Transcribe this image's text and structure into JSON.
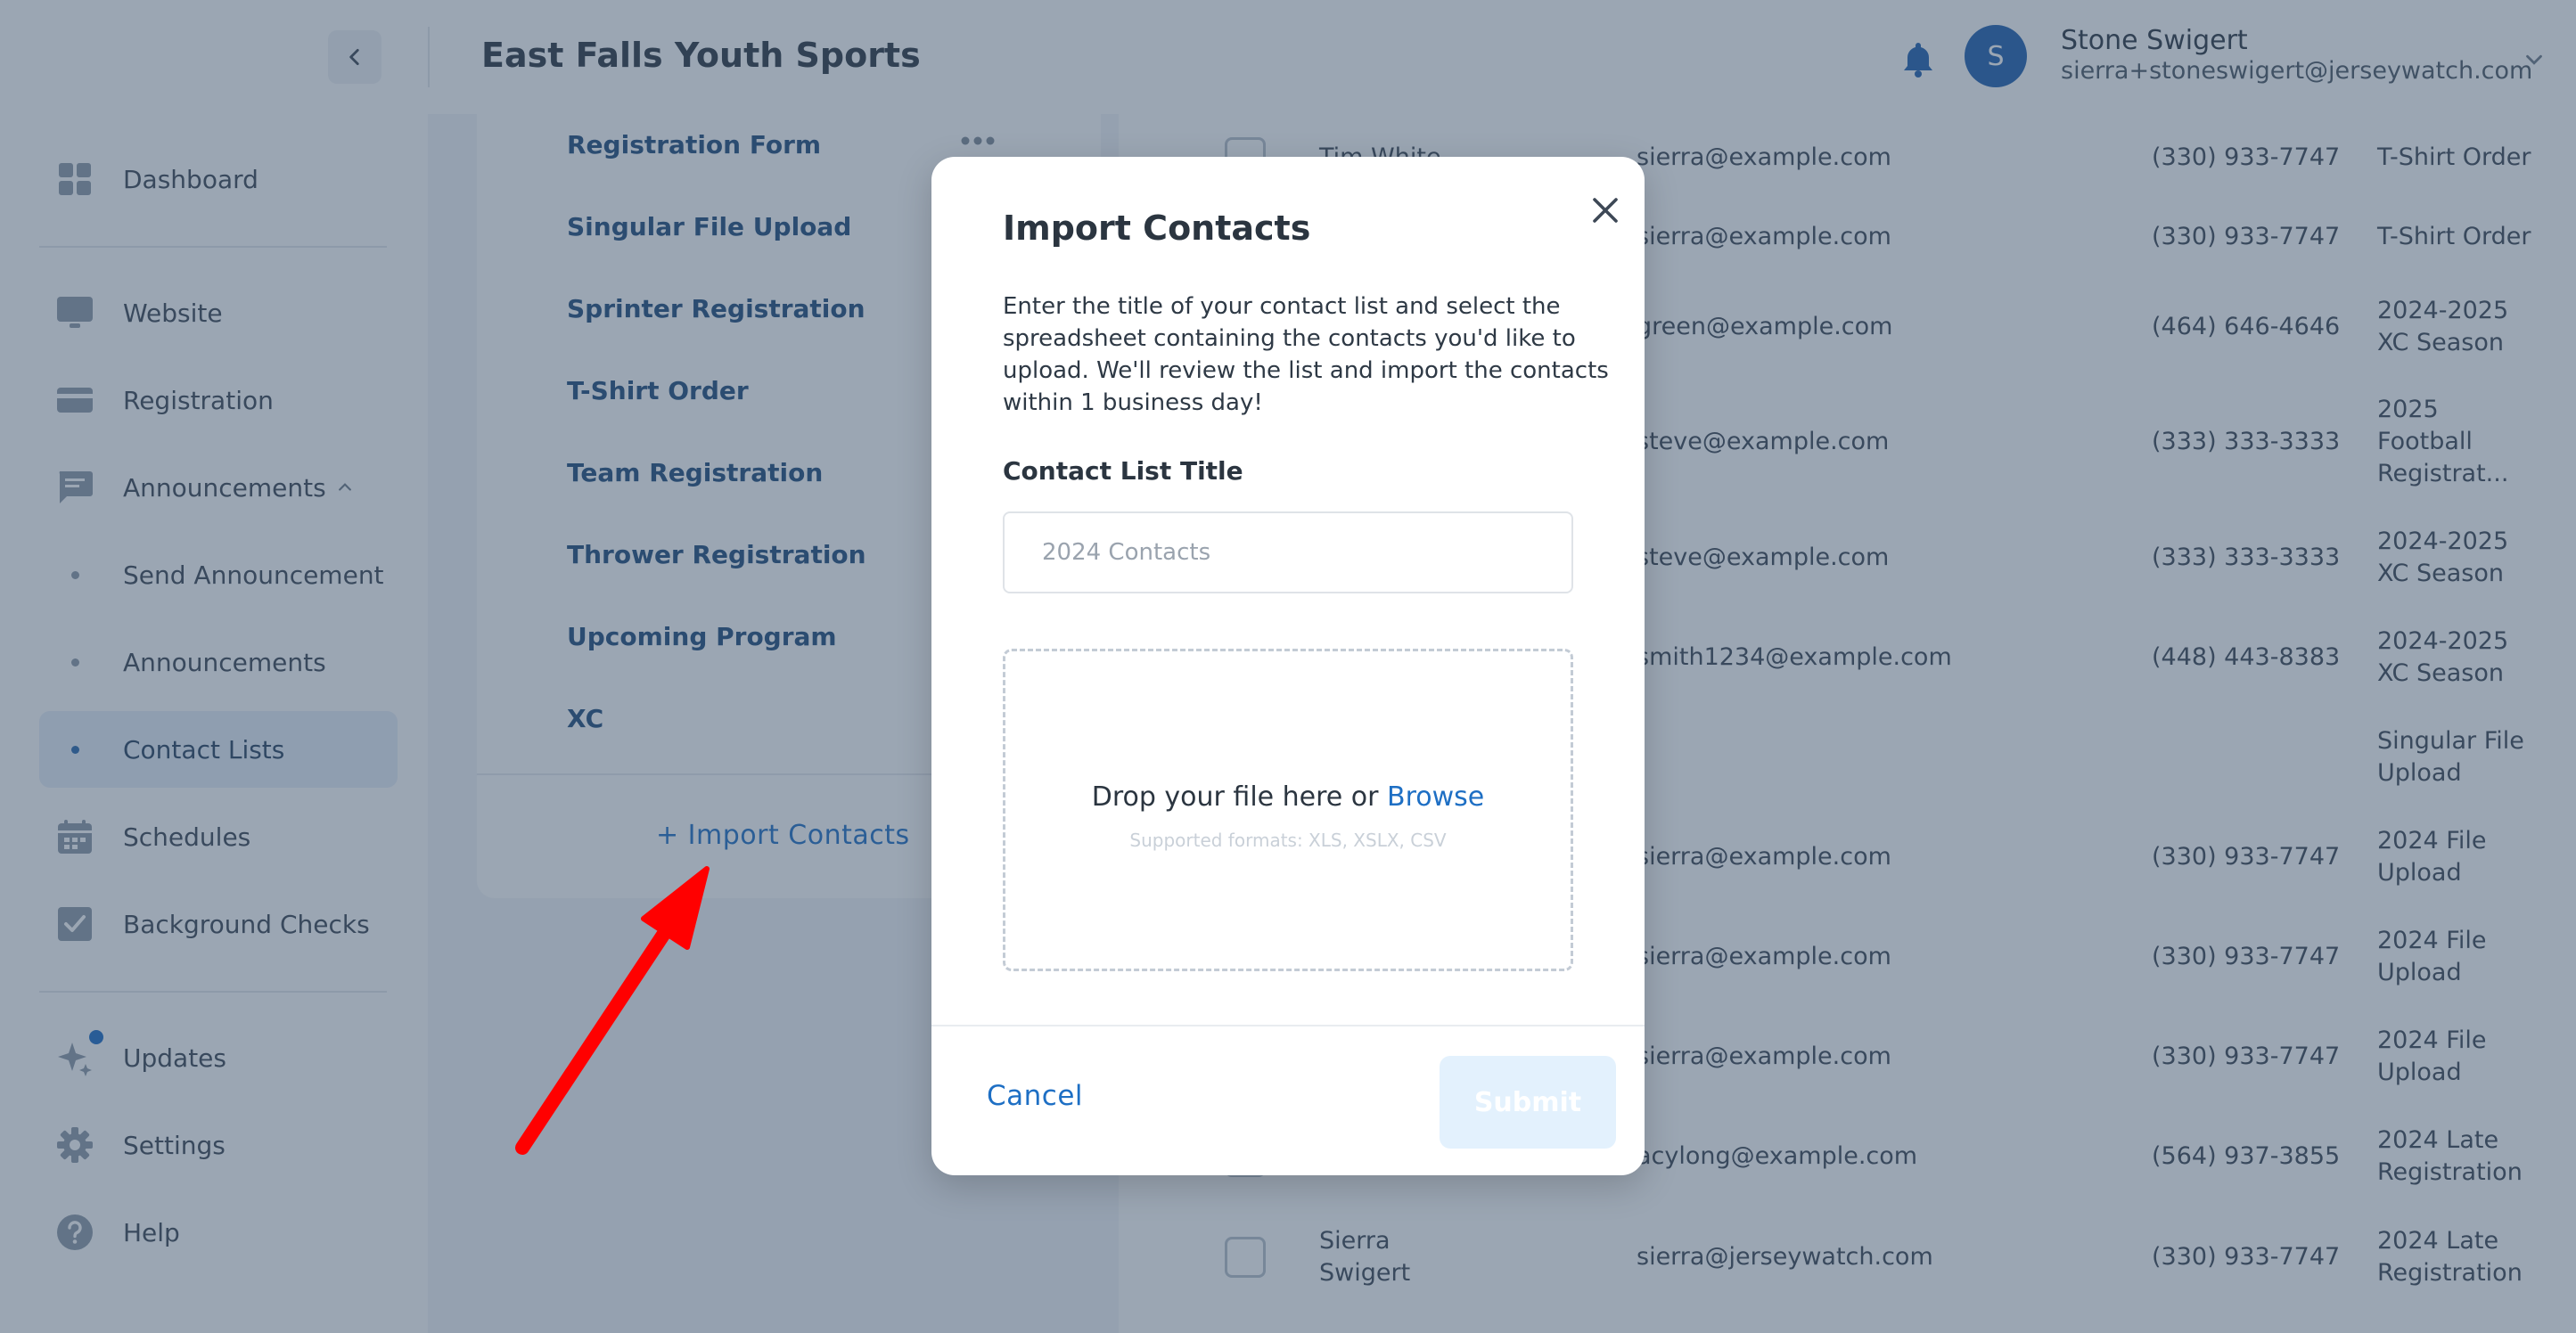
{
  "header": {
    "org_title": "East Falls Youth Sports",
    "user": {
      "initial": "S",
      "name": "Stone Swigert",
      "email": "sierra+stoneswigert@jerseywatch.com"
    }
  },
  "sidebar": {
    "items": [
      {
        "label": "Dashboard",
        "icon": "dashboard-icon"
      },
      {
        "label": "Website",
        "icon": "monitor-icon"
      },
      {
        "label": "Registration",
        "icon": "card-icon"
      },
      {
        "label": "Announcements",
        "icon": "chat-icon"
      },
      {
        "label": "Send Announcement"
      },
      {
        "label": "Announcements"
      },
      {
        "label": "Contact Lists",
        "active": true
      },
      {
        "label": "Schedules",
        "icon": "calendar-icon"
      },
      {
        "label": "Background Checks",
        "icon": "checkbox-icon"
      },
      {
        "label": "Updates",
        "icon": "sparkle-icon"
      },
      {
        "label": "Settings",
        "icon": "gear-icon"
      },
      {
        "label": "Help",
        "icon": "help-icon"
      }
    ]
  },
  "contact_lists": {
    "items": [
      "Registration Form",
      "Singular File Upload",
      "Sprinter Registration",
      "T-Shirt Order",
      "Team Registration",
      "Thrower Registration",
      "Upcoming Program",
      "XC"
    ],
    "import_label": "+ Import Contacts"
  },
  "table": {
    "rows": [
      {
        "name": "Tim White",
        "email": "sierra@example.com",
        "phone": "(330) 933-7747",
        "program": "T-Shirt Order"
      },
      {
        "name": "",
        "email": "sierra@example.com",
        "phone": "(330) 933-7747",
        "program": "T-Shirt Order"
      },
      {
        "name": "",
        "email": "green@example.com",
        "phone": "(464) 646-4646",
        "program": "2024-2025\nXC Season"
      },
      {
        "name": "",
        "email": "steve@example.com",
        "phone": "(333) 333-3333",
        "program": "2025\nFootball\nRegistrat..."
      },
      {
        "name": "",
        "email": "steve@example.com",
        "phone": "(333) 333-3333",
        "program": "2024-2025\nXC Season"
      },
      {
        "name": "",
        "email": "smith1234@example.com",
        "phone": "(448) 443-8383",
        "program": "2024-2025\nXC Season"
      },
      {
        "name": "",
        "email": "",
        "phone": "",
        "program": "Singular File\nUpload"
      },
      {
        "name": "",
        "email": "sierra@example.com",
        "phone": "(330) 933-7747",
        "program": "2024 File\nUpload"
      },
      {
        "name": "",
        "email": "sierra@example.com",
        "phone": "(330) 933-7747",
        "program": "2024 File\nUpload"
      },
      {
        "name": "",
        "email": "sierra@example.com",
        "phone": "(330) 933-7747",
        "program": "2024 File\nUpload"
      },
      {
        "name": "",
        "email": "acylong@example.com",
        "phone": "(564) 937-3855",
        "program": "2024 Late\nRegistration"
      },
      {
        "name": "Sierra\nSwigert",
        "email": "sierra@jerseywatch.com",
        "phone": "(330) 933-7747",
        "program": "2024 Late\nRegistration"
      }
    ]
  },
  "modal": {
    "title": "Import Contacts",
    "description": "Enter the title of your contact list and select the spreadsheet containing the contacts you'd like to upload. We'll review the list and import the contacts within 1 business day!",
    "field_label": "Contact List Title",
    "field_placeholder": "2024 Contacts",
    "field_value": "",
    "drop_text": "Drop your file here or",
    "browse_label": "Browse",
    "formats": "Supported formats: XLS, XSLX, CSV",
    "cancel_label": "Cancel",
    "submit_label": "Submit"
  },
  "colors": {
    "accent": "#1e6fc4",
    "avatar": "#1e5fae",
    "list_item": "#1f4a7a",
    "annotation_arrow": "#ff0000"
  }
}
